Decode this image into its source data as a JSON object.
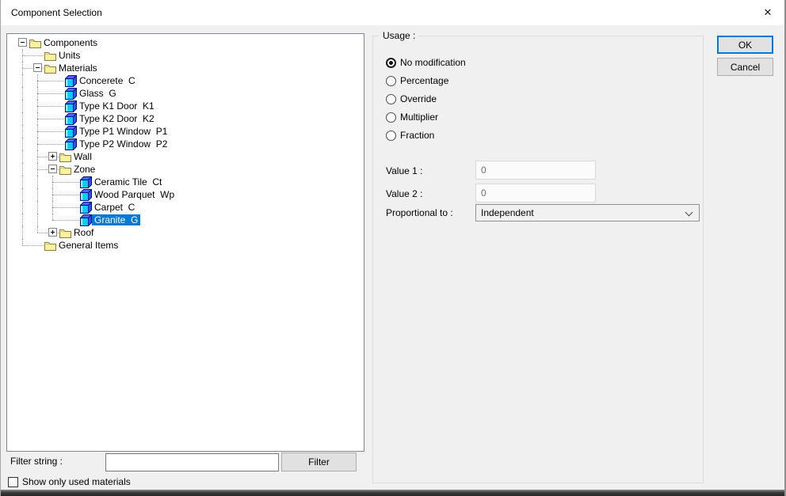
{
  "window": {
    "title": "Component Selection",
    "close_glyph": "✕"
  },
  "tree": {
    "items": [
      {
        "name": "Components",
        "level": 0,
        "icon": "folder",
        "expand": "minus",
        "selected": false
      },
      {
        "name": "Units",
        "level": 1,
        "icon": "folder",
        "expand": null,
        "selected": false
      },
      {
        "name": "Materials",
        "level": 1,
        "icon": "folder",
        "expand": "minus",
        "selected": false
      },
      {
        "name": "Concerete",
        "code": "C",
        "level": 2,
        "icon": "cube",
        "expand": null,
        "selected": false
      },
      {
        "name": "Glass",
        "code": "G",
        "level": 2,
        "icon": "cube",
        "expand": null,
        "selected": false
      },
      {
        "name": "Type K1 Door",
        "code": "K1",
        "level": 2,
        "icon": "cube",
        "expand": null,
        "selected": false
      },
      {
        "name": "Type K2 Door",
        "code": "K2",
        "level": 2,
        "icon": "cube",
        "expand": null,
        "selected": false
      },
      {
        "name": "Type P1 Window",
        "code": "P1",
        "level": 2,
        "icon": "cube",
        "expand": null,
        "selected": false
      },
      {
        "name": "Type P2 Window",
        "code": "P2",
        "level": 2,
        "icon": "cube",
        "expand": null,
        "selected": false
      },
      {
        "name": "Wall",
        "level": 2,
        "icon": "folder",
        "expand": "plus",
        "selected": false
      },
      {
        "name": "Zone",
        "level": 2,
        "icon": "folder",
        "expand": "minus",
        "selected": false
      },
      {
        "name": "Ceramic Tile",
        "code": "Ct",
        "level": 3,
        "icon": "cube",
        "expand": null,
        "selected": false
      },
      {
        "name": "Wood Parquet",
        "code": "Wp",
        "level": 3,
        "icon": "cube",
        "expand": null,
        "selected": false
      },
      {
        "name": "Carpet",
        "code": "C",
        "level": 3,
        "icon": "cube",
        "expand": null,
        "selected": false
      },
      {
        "name": "Granite",
        "code": "G",
        "level": 3,
        "icon": "cube",
        "expand": null,
        "selected": true
      },
      {
        "name": "Roof",
        "level": 2,
        "icon": "folder",
        "expand": "plus",
        "selected": false
      },
      {
        "name": "General Items",
        "level": 1,
        "icon": "folder",
        "expand": null,
        "selected": false
      }
    ]
  },
  "usage": {
    "legend": "Usage :",
    "options": [
      {
        "label": "No modification",
        "selected": true
      },
      {
        "label": "Percentage",
        "selected": false
      },
      {
        "label": "Override",
        "selected": false
      },
      {
        "label": "Multiplier",
        "selected": false
      },
      {
        "label": "Fraction",
        "selected": false
      }
    ]
  },
  "fields": {
    "value1_label": "Value 1 :",
    "value1": "0",
    "value2_label": "Value 2 :",
    "value2": "0",
    "proportional_label": "Proportional to :",
    "proportional_value": "Independent"
  },
  "buttons": {
    "ok": "OK",
    "cancel": "Cancel",
    "filter": "Filter"
  },
  "filter": {
    "label": "Filter string :",
    "value": ""
  },
  "footer": {
    "checkbox_label": "Show only used materials",
    "checked": false
  },
  "colors": {
    "selection": "#0078d7",
    "ok_border": "#0078d7"
  }
}
